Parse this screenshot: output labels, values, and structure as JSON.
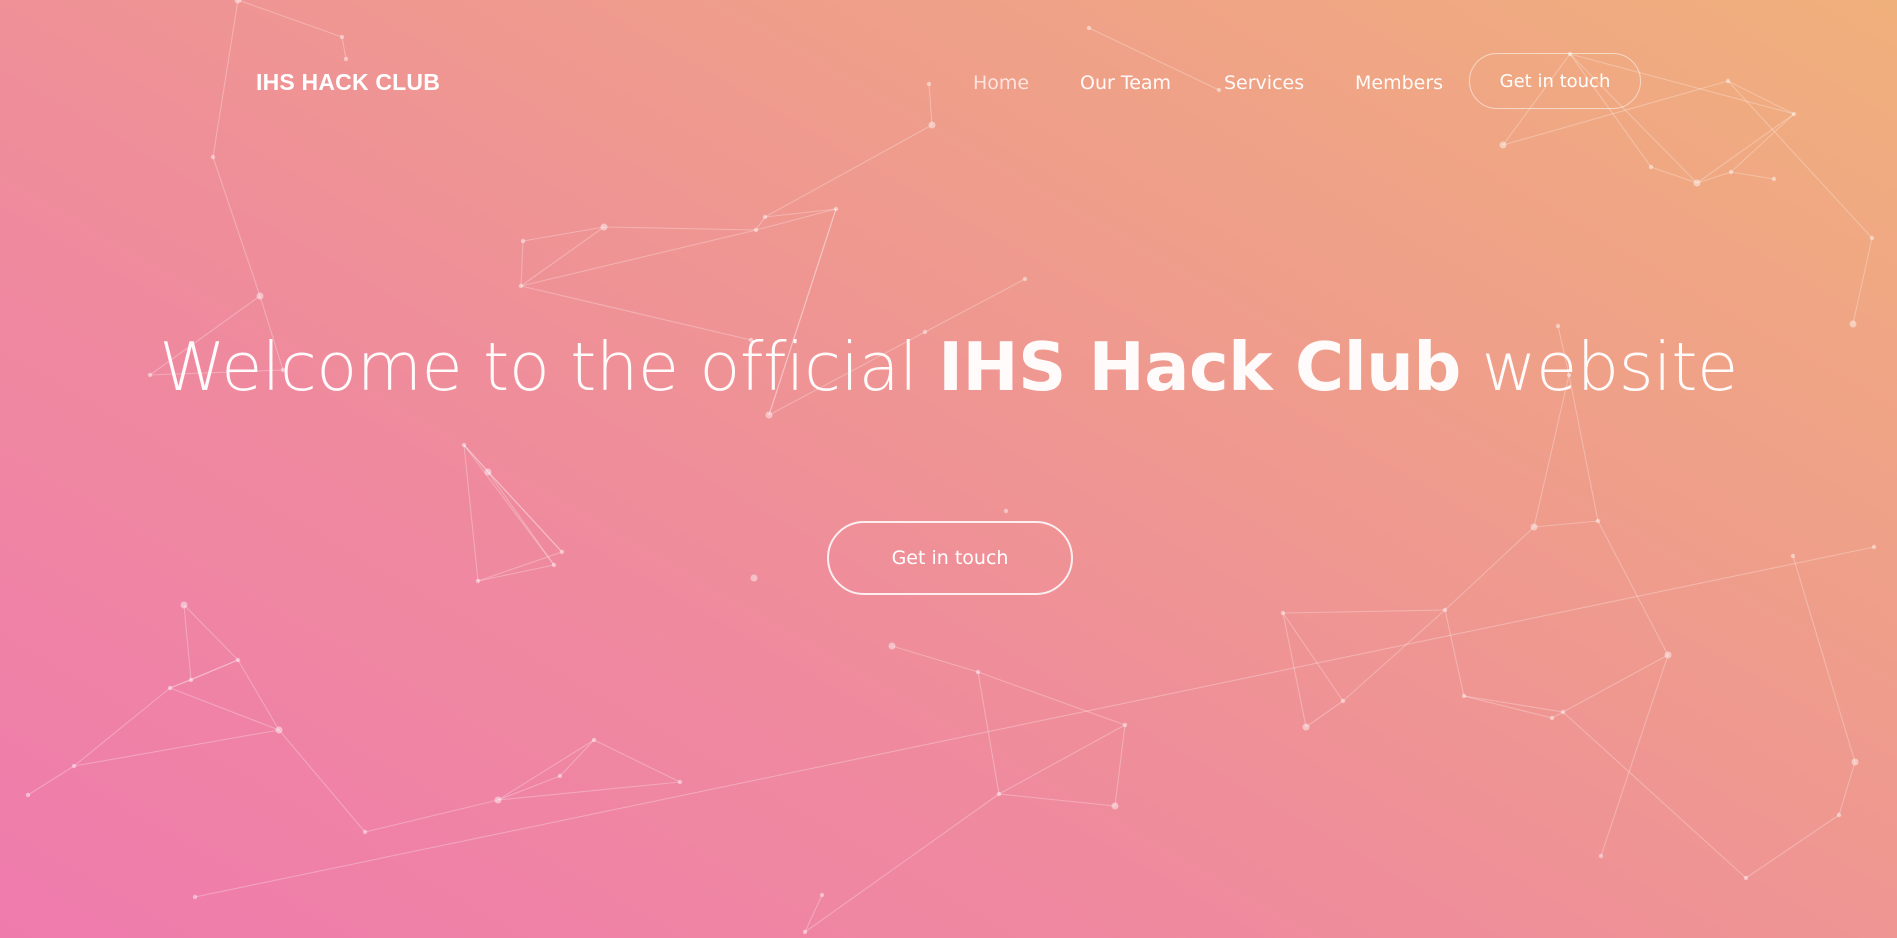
{
  "brand": {
    "name": "IHS HACK CLUB"
  },
  "nav": {
    "items": [
      {
        "label": "Home",
        "active": true
      },
      {
        "label": "Our Team"
      },
      {
        "label": "Services"
      },
      {
        "label": "Members"
      }
    ],
    "cta_label": "Get in touch"
  },
  "hero": {
    "title_prefix": "Welcome to the official ",
    "title_bold": "IHS Hack Club",
    "title_suffix": " website",
    "cta_label": "Get in touch"
  },
  "theme": {
    "gradient_start": "#ef7bad",
    "gradient_end": "#f0b07c",
    "text_color": "#ffffff"
  },
  "background": {
    "effect": "particle-network"
  }
}
